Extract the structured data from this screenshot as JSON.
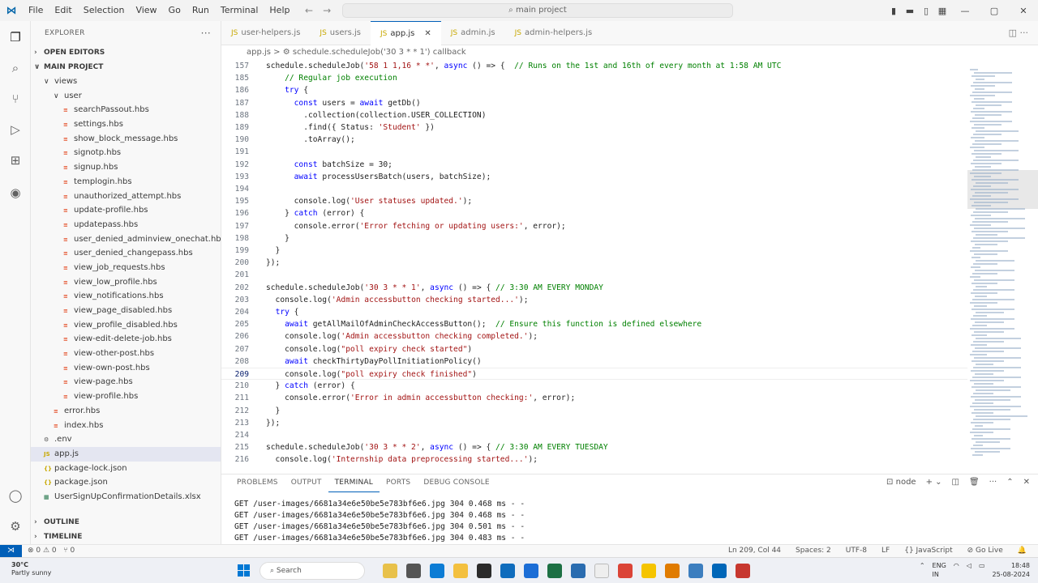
{
  "titlebar": {
    "menu": [
      "File",
      "Edit",
      "Selection",
      "View",
      "Go",
      "Run",
      "Terminal",
      "Help"
    ],
    "search": "main project"
  },
  "sidebar": {
    "explorer_label": "EXPLORER",
    "open_editors": "OPEN EDITORS",
    "project": "MAIN PROJECT",
    "outline": "OUTLINE",
    "timeline": "TIMELINE",
    "tree": [
      {
        "label": "views",
        "type": "folder",
        "indent": 1,
        "chev": "∨"
      },
      {
        "label": "user",
        "type": "folder",
        "indent": 2,
        "chev": "∨"
      },
      {
        "label": "searchPassout.hbs",
        "type": "hbs",
        "indent": 3
      },
      {
        "label": "settings.hbs",
        "type": "hbs",
        "indent": 3
      },
      {
        "label": "show_block_message.hbs",
        "type": "hbs",
        "indent": 3
      },
      {
        "label": "signotp.hbs",
        "type": "hbs",
        "indent": 3
      },
      {
        "label": "signup.hbs",
        "type": "hbs",
        "indent": 3
      },
      {
        "label": "templogin.hbs",
        "type": "hbs",
        "indent": 3
      },
      {
        "label": "unauthorized_attempt.hbs",
        "type": "hbs",
        "indent": 3
      },
      {
        "label": "update-profile.hbs",
        "type": "hbs",
        "indent": 3
      },
      {
        "label": "updatepass.hbs",
        "type": "hbs",
        "indent": 3
      },
      {
        "label": "user_denied_adminview_onechat.hbs",
        "type": "hbs",
        "indent": 3
      },
      {
        "label": "user_denied_changepass.hbs",
        "type": "hbs",
        "indent": 3
      },
      {
        "label": "view_job_requests.hbs",
        "type": "hbs",
        "indent": 3
      },
      {
        "label": "view_low_profile.hbs",
        "type": "hbs",
        "indent": 3
      },
      {
        "label": "view_notifications.hbs",
        "type": "hbs",
        "indent": 3
      },
      {
        "label": "view_page_disabled.hbs",
        "type": "hbs",
        "indent": 3
      },
      {
        "label": "view_profile_disabled.hbs",
        "type": "hbs",
        "indent": 3
      },
      {
        "label": "view-edit-delete-job.hbs",
        "type": "hbs",
        "indent": 3
      },
      {
        "label": "view-other-post.hbs",
        "type": "hbs",
        "indent": 3
      },
      {
        "label": "view-own-post.hbs",
        "type": "hbs",
        "indent": 3
      },
      {
        "label": "view-page.hbs",
        "type": "hbs",
        "indent": 3
      },
      {
        "label": "view-profile.hbs",
        "type": "hbs",
        "indent": 3
      },
      {
        "label": "error.hbs",
        "type": "hbs",
        "indent": 2
      },
      {
        "label": "index.hbs",
        "type": "hbs",
        "indent": 2
      },
      {
        "label": ".env",
        "type": "env",
        "indent": 1
      },
      {
        "label": "app.js",
        "type": "js",
        "indent": 1,
        "selected": true
      },
      {
        "label": "package-lock.json",
        "type": "json",
        "indent": 1
      },
      {
        "label": "package.json",
        "type": "json",
        "indent": 1
      },
      {
        "label": "UserSignUpConfirmationDetails.xlsx",
        "type": "xlsx",
        "indent": 1
      }
    ]
  },
  "tabs": [
    {
      "label": "user-helpers.js",
      "active": false
    },
    {
      "label": "users.js",
      "active": false
    },
    {
      "label": "app.js",
      "active": true
    },
    {
      "label": "admin.js",
      "active": false
    },
    {
      "label": "admin-helpers.js",
      "active": false
    }
  ],
  "breadcrumb": "app.js  >  ⚙ schedule.scheduleJob('30 3 * * 1') callback",
  "code": [
    {
      "n": "157",
      "t": "schedule.scheduleJob('58 1 1,16 * *', async () => {  // Runs on the 1st and 16th of every month at 1:58 AM UTC"
    },
    {
      "n": "185",
      "t": "    // Regular job execution"
    },
    {
      "n": "186",
      "t": "    try {"
    },
    {
      "n": "187",
      "t": "      const users = await getDb()"
    },
    {
      "n": "188",
      "t": "        .collection(collection.USER_COLLECTION)"
    },
    {
      "n": "189",
      "t": "        .find({ Status: 'Student' })"
    },
    {
      "n": "190",
      "t": "        .toArray();"
    },
    {
      "n": "191",
      "t": ""
    },
    {
      "n": "192",
      "t": "      const batchSize = 30;"
    },
    {
      "n": "193",
      "t": "      await processUsersBatch(users, batchSize);"
    },
    {
      "n": "194",
      "t": ""
    },
    {
      "n": "195",
      "t": "      console.log('User statuses updated.');"
    },
    {
      "n": "196",
      "t": "    } catch (error) {"
    },
    {
      "n": "197",
      "t": "      console.error('Error fetching or updating users:', error);"
    },
    {
      "n": "198",
      "t": "    }"
    },
    {
      "n": "199",
      "t": "  }"
    },
    {
      "n": "200",
      "t": "});"
    },
    {
      "n": "201",
      "t": ""
    },
    {
      "n": "202",
      "t": "schedule.scheduleJob('30 3 * * 1', async () => { // 3:30 AM EVERY MONDAY"
    },
    {
      "n": "203",
      "t": "  console.log('Admin accessbutton checking started...');"
    },
    {
      "n": "204",
      "t": "  try {"
    },
    {
      "n": "205",
      "t": "    await getAllMailOfAdminCheckAccessButton();  // Ensure this function is defined elsewhere"
    },
    {
      "n": "206",
      "t": "    console.log('Admin accessbutton checking completed.');"
    },
    {
      "n": "207",
      "t": "    console.log(\"poll expiry check started\")"
    },
    {
      "n": "208",
      "t": "    await checkThirtyDayPollInitiationPolicy()"
    },
    {
      "n": "209",
      "t": "    console.log(\"poll expiry check finished\")",
      "current": true
    },
    {
      "n": "210",
      "t": "  } catch (error) {"
    },
    {
      "n": "211",
      "t": "    console.error('Error in admin accessbutton checking:', error);"
    },
    {
      "n": "212",
      "t": "  }"
    },
    {
      "n": "213",
      "t": "});"
    },
    {
      "n": "214",
      "t": ""
    },
    {
      "n": "215",
      "t": "schedule.scheduleJob('30 3 * * 2', async () => { // 3:30 AM EVERY TUESDAY"
    },
    {
      "n": "216",
      "t": "  console.log('Internship data preprocessing started...');"
    }
  ],
  "panel": {
    "tabs": [
      "PROBLEMS",
      "OUTPUT",
      "TERMINAL",
      "PORTS",
      "DEBUG CONSOLE"
    ],
    "active": "TERMINAL",
    "shell": "node",
    "terminal": [
      "GET /user-images/6681a34e6e50be5e783bf6e6.jpg 304 0.468 ms - -",
      "GET /user-images/6681a34e6e50be5e783bf6e6.jpg 304 0.468 ms - -",
      "GET /user-images/6681a34e6e50be5e783bf6e6.jpg 304 0.501 ms - -",
      "GET /user-images/6681a34e6e50be5e783bf6e6.jpg 304 0.483 ms - -"
    ]
  },
  "status": {
    "errors": "⊗ 0  ⚠ 0",
    "ports": "⑂ 0",
    "position": "Ln 209, Col 44",
    "spaces": "Spaces: 2",
    "encoding": "UTF-8",
    "eol": "LF",
    "language": "{} JavaScript",
    "golive": "⊘ Go Live"
  },
  "taskbar": {
    "temp": "30°C",
    "weather": "Partly sunny",
    "search": "Search",
    "lang": "ENG",
    "region": "IN",
    "time": "18:48",
    "date": "25-08-2024"
  },
  "colors": {
    "accent": "#005fb8",
    "keyword": "#0000ff",
    "string": "#a31515",
    "comment": "#008000"
  }
}
